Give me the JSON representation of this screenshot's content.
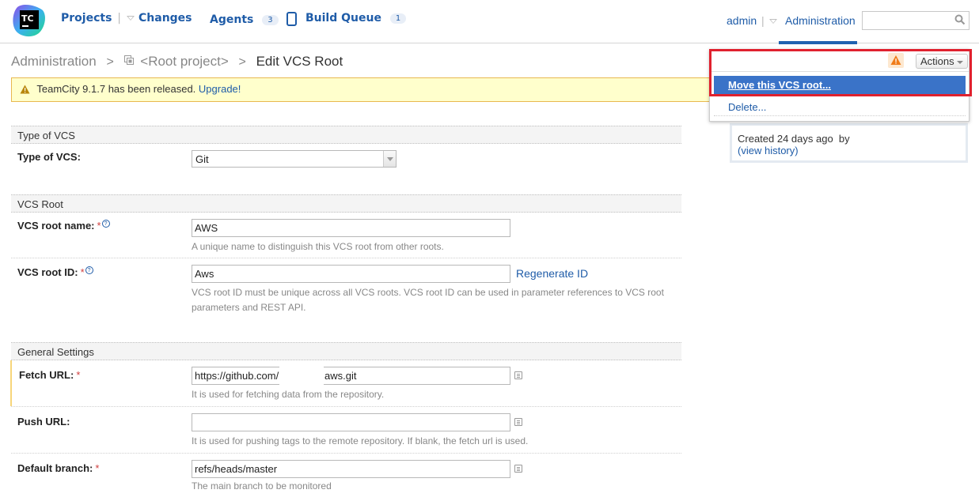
{
  "header": {
    "nav": [
      {
        "label": "Projects",
        "has_menu": true
      },
      {
        "label": "Changes"
      },
      {
        "label": "Agents",
        "badge": "3"
      },
      {
        "label": "Build Queue",
        "badge": "1"
      }
    ],
    "user": "admin",
    "admin_tab": "Administration",
    "search": {
      "value": "",
      "placeholder": ""
    },
    "logo_text": "TC"
  },
  "breadcrumb": {
    "items": [
      "Administration",
      "<Root project>"
    ],
    "current": "Edit VCS Root"
  },
  "banner": {
    "text": "TeamCity 9.1.7 has been released.",
    "link": "Upgrade!"
  },
  "actions": {
    "button_label": "Actions",
    "items": [
      "Move this VCS root...",
      "Delete..."
    ],
    "highlighted_item": "Move this VCS root..."
  },
  "info": {
    "created": "Created 24 days ago  by",
    "history_open": "(",
    "history_link": "view history",
    "history_close": ")"
  },
  "form": {
    "sections": [
      {
        "title": "Type of VCS",
        "fields": [
          {
            "label": "Type of VCS:",
            "type": "select",
            "value": "Git"
          }
        ]
      },
      {
        "title": "VCS Root",
        "fields": [
          {
            "label": "VCS root name:",
            "required": true,
            "help": true,
            "value": "AWS",
            "note": "A unique name to distinguish this VCS root from other roots."
          },
          {
            "label": "VCS root ID:",
            "required": true,
            "help": true,
            "value": "Aws",
            "action": "Regenerate ID",
            "note": "VCS root ID must be unique across all VCS roots. VCS root ID can be used in parameter references to VCS root parameters and REST API."
          }
        ]
      },
      {
        "title": "General Settings",
        "fields": [
          {
            "label": "Fetch URL:",
            "required": true,
            "value": "https://github.com/                aws.git",
            "note": "It is used for fetching data from the repository."
          },
          {
            "label": "Push URL:",
            "required": false,
            "value": "",
            "note": "It is used for pushing tags to the remote repository. If blank, the fetch url is used."
          },
          {
            "label": "Default branch:",
            "required": true,
            "value": "refs/heads/master",
            "note": "The main branch to be monitored"
          }
        ]
      }
    ],
    "required_mark": "*",
    "help_mark": "?"
  },
  "colors": {
    "link": "#1f5ca8",
    "active_tab": "#1f62b0",
    "menu_highlight": "#3a73c8",
    "annotation_frame": "#e0212e",
    "banner_bg": "#ffffcc"
  }
}
